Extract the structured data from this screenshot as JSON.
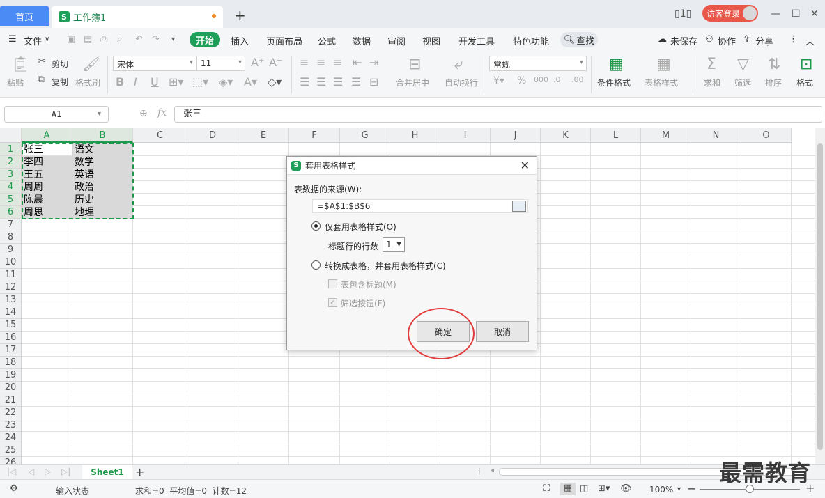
{
  "tabs": {
    "home": "首页",
    "doc": "工作簿1"
  },
  "titlebar": {
    "login": "访客登录"
  },
  "menu": {
    "file": "文件",
    "items": [
      "开始",
      "插入",
      "页面布局",
      "公式",
      "数据",
      "审阅",
      "视图",
      "开发工具",
      "特色功能"
    ],
    "search": "查找",
    "unsaved": "未保存",
    "collab": "协作",
    "share": "分享"
  },
  "ribbon": {
    "paste": "粘贴",
    "cut": "剪切",
    "copy": "复制",
    "format_painter": "格式刷",
    "font_name": "宋体",
    "font_size": "11",
    "merge_center": "合并居中",
    "wrap": "自动换行",
    "number_format": "常规",
    "cond_format": "条件格式",
    "table_style": "表格样式",
    "sum": "求和",
    "filter": "筛选",
    "sort": "排序",
    "format": "格式"
  },
  "formula": {
    "namebox": "A1",
    "content": "张三"
  },
  "grid": {
    "columns": [
      "A",
      "B",
      "C",
      "D",
      "E",
      "F",
      "G",
      "H",
      "I",
      "J",
      "K",
      "L",
      "M",
      "N",
      "O"
    ],
    "rows": [
      "1",
      "2",
      "3",
      "4",
      "5",
      "6",
      "7",
      "8",
      "9",
      "10",
      "11",
      "12",
      "13",
      "14",
      "15",
      "16",
      "17",
      "18",
      "19",
      "20",
      "21",
      "22",
      "23",
      "24",
      "25",
      "26"
    ],
    "col_a": [
      "张三",
      "李四",
      "王五",
      "周周",
      "陈晨",
      "周思"
    ],
    "col_b": [
      "语文",
      "数学",
      "英语",
      "政治",
      "历史",
      "地理"
    ]
  },
  "sheets": {
    "active": "Sheet1"
  },
  "status": {
    "mode": "输入状态",
    "summary": "求和=0  平均值=0  计数=12",
    "zoom": "100%"
  },
  "dialog": {
    "title": "套用表格样式",
    "source_label": "表数据的来源(W):",
    "source_value": "=$A$1:$B$6",
    "opt1": "仅套用表格样式(O)",
    "header_rows_label": "标题行的行数",
    "header_rows_value": "1",
    "opt2": "转换成表格，并套用表格样式(C)",
    "chk_header": "表包含标题(M)",
    "chk_filter": "筛选按钮(F)",
    "ok": "确定",
    "cancel": "取消"
  },
  "watermark": "最需教育"
}
